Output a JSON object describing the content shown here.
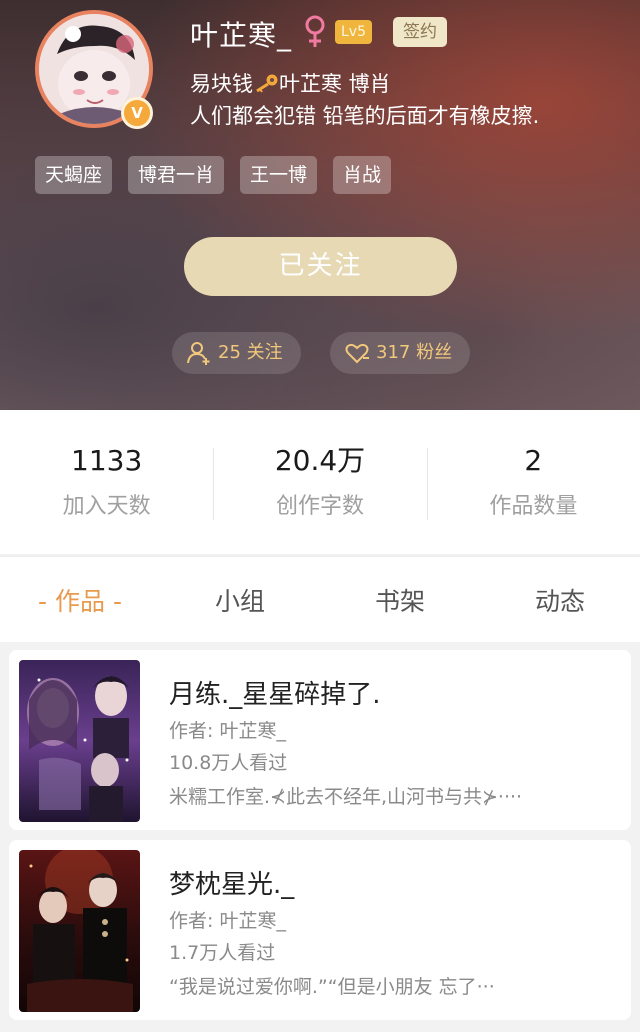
{
  "profile": {
    "username": "叶芷寒_",
    "level": "Lv5",
    "sign_badge": "签约",
    "bio_line1_a": "易块钱",
    "bio_line1_b": "叶芷寒 博肖",
    "bio_line2": "人们都会犯错 铅笔的后面才有橡皮擦.",
    "verified_mark": "V",
    "tags": [
      "天蝎座",
      "博君一肖",
      "王一博",
      "肖战"
    ],
    "follow_button": "已关注",
    "following": "25 关注",
    "fans": "317 粉丝"
  },
  "stats": [
    {
      "value": "1133",
      "label": "加入天数"
    },
    {
      "value": "20.4万",
      "label": "创作字数"
    },
    {
      "value": "2",
      "label": "作品数量"
    }
  ],
  "tabs": [
    "- 作品 -",
    "小组",
    "书架",
    "动态"
  ],
  "books": [
    {
      "title": "月练._星星碎掉了.",
      "author": "作者: 叶芷寒_",
      "views": "10.8万人看过",
      "desc": "米糯工作室.⊀此去不经年,山河书与共⊁····"
    },
    {
      "title": "梦枕星光._",
      "author": "作者: 叶芷寒_",
      "views": "1.7万人看过",
      "desc": "“我是说过爱你啊.”“但是小朋友  忘了···"
    }
  ],
  "colors": {
    "accent": "#e89a4e",
    "follow_pill_text": "#f1c87c",
    "level_badge": "#f0b53c",
    "avatar_border": "#e9825f"
  },
  "icons": [
    "female-icon",
    "key-icon",
    "person-add-icon",
    "heart-icon",
    "verified-icon"
  ]
}
